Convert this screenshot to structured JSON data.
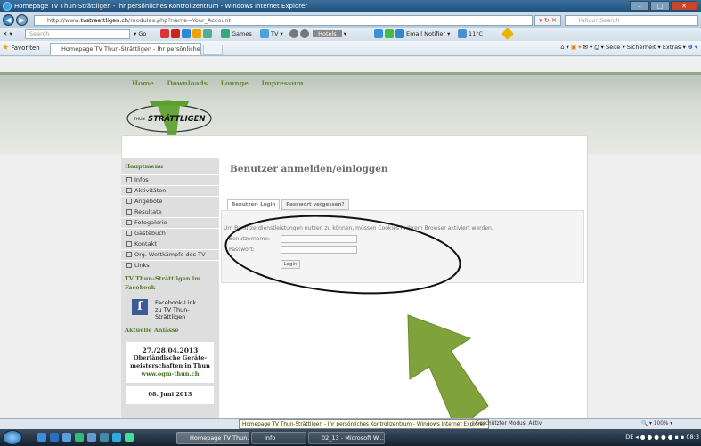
{
  "window": {
    "title": "Homepage TV Thun-Strättligen - Ihr persönliches Kontrollzentrum - Windows Internet Explorer",
    "buttons": {
      "minimize": "–",
      "maximize": "□",
      "close": "✕"
    }
  },
  "addressbar": {
    "url_prefix": "http://www.",
    "url_domain": "tvstraettligen.ch",
    "url_path": "/modules.php?name=Your_Account",
    "search_placeholder": "Yahoo! Search"
  },
  "toolbar": {
    "search_placeholder": "Search",
    "go_label": "Go",
    "games_label": "Games",
    "tv_label": "TV",
    "hotels_label": "Hotels",
    "email_label": "Email Notifier",
    "weather_label": "11°C"
  },
  "favorites": {
    "label": "Favoriten",
    "tab_title": "Homepage TV Thun-Strättligen - Ihr persönliches...",
    "cmd_page": "Seite",
    "cmd_security": "Sicherheit",
    "cmd_extras": "Extras"
  },
  "site": {
    "nav": [
      "Home",
      "Downloads",
      "Lounge",
      "Impressum"
    ],
    "logo_small": "THUN",
    "logo_big": "STRÄTTLIGEN",
    "logo_tv": "TV",
    "sidebar": {
      "heading": "Hauptmenu",
      "items": [
        "Infos",
        "Aktivitäten",
        "Angebote",
        "Resultate",
        "Fotogalerie",
        "Gästebuch",
        "Kontakt",
        "Org. Wettkämpfe des TV",
        "Links"
      ],
      "facebook_heading": "TV Thun-Strättligen im Facebook",
      "facebook_line1": "Facebook-Link",
      "facebook_line2": "zu TV Thun-Strättligen",
      "events_heading": "Aktuelle Anlässe",
      "event_date": "27./28.04.2013",
      "event_title": "Oberländische Geräte-meisterschaften in Thun",
      "event_link": "www.ogm-thun.ch",
      "event2_date": "08. Juni 2013"
    },
    "main": {
      "title": "Benutzer anmelden/einloggen",
      "tab_login": "Benutzer- Login",
      "tab_forgot": "Passwort vergessen?",
      "info": "Um Benutzerdienstleistungen nutzen zu können, müssen Cookies in Ihrem Browser aktiviert werden.",
      "username_label": "Benutzername:",
      "password_label": "Passwort:",
      "login_button": "Login"
    }
  },
  "statusbar": {
    "tooltip": "Homepage TV Thun-Strättligen - Ihr persönliches Kontrollzentrum - Windows Internet Explorer",
    "mode": "| Geschützter Modus: Aktiv",
    "zoom": "100%"
  },
  "taskbar": {
    "tasks": [
      "Homepage TV Thun...",
      "Info",
      "02_13 - Microsoft W..."
    ],
    "tray": "DE",
    "clock": "08:3"
  },
  "colors": {
    "annotation_green": "#7fa33a",
    "site_green": "#6a8a3a"
  }
}
